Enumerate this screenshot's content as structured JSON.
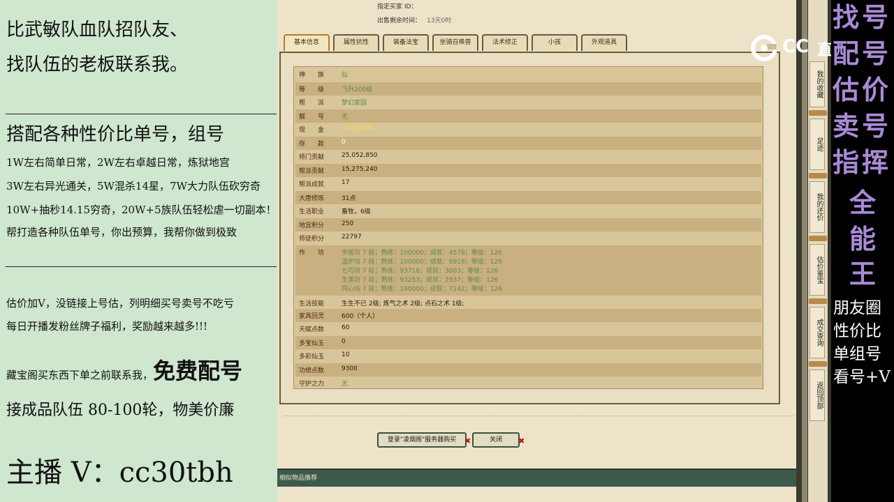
{
  "promo": {
    "l1": "比武敏队血队招队友、",
    "l2": "找队伍的老板联系我。",
    "l3": "搭配各种性价比单号，组号",
    "l4": "1W左右简单日常，2W左右卓越日常，炼狱地宫",
    "l5": "3W左右异光通关，5W混杀14星，7W大力队伍砍穷奇",
    "l6": "10W+抽秒14.15穷奇，20W+5族队伍轻松虐一切副本！",
    "l7": "帮打造各种队伍单号，你出预算，我帮你做到极致",
    "l8": "估价加V，没链接上号估，列明细买号卖号不吃亏",
    "l9": "每日开播发粉丝牌子福利，奖励越来越多!!!",
    "l10a": "藏宝阁买东西下单之前联系我，",
    "l10b": "免费配号",
    "l11": "接成品队伍 80-100轮，物美价廉",
    "l12": "主播 V：cc30tbh"
  },
  "header": {
    "buyer_label": "指定买家 ID：",
    "time_label": "出售剩余时间：",
    "time_value": "13天0时"
  },
  "tabs": [
    "基本信息",
    "属性抗性",
    "装备法宝",
    "坐骑召唤兽",
    "法术修正",
    "小孩",
    "外观道具"
  ],
  "info": {
    "r1": {
      "k": "神　　族",
      "v": "仙"
    },
    "r2": {
      "k": "等　　级",
      "v": "飞升200级"
    },
    "r3": {
      "k": "帮　　派",
      "v": "梦幻家园"
    },
    "r4": {
      "k": "靓　　号",
      "v": "无"
    },
    "r5": {
      "k": "现　　金",
      "v": "7,070,000"
    },
    "r6": {
      "k": "存　　款",
      "v": "0"
    },
    "r7": {
      "k": "师门贡献",
      "v": "25,052,850"
    },
    "r8": {
      "k": "帮派贡献",
      "v": "15,275,240"
    },
    "r9": {
      "k": "帮派成就",
      "v": "17"
    },
    "r10": {
      "k": "大唐修炼",
      "v": "31点"
    },
    "r11": {
      "k": "生活职业",
      "v": "畜牧，6级"
    },
    "r12": {
      "k": "地宫积分",
      "v": "250"
    },
    "r13": {
      "k": "师徒积分",
      "v": "22797"
    },
    "r14": {
      "k": "作　　坊"
    },
    "workshops": [
      "步摇坊 7 段；熟练：100000；成就：4578；等级：126",
      "温炉坊 7 段；熟练：100000；成就：6918；等级：126",
      "七巧坊 7 段；熟练：93716；成就：3003；等级：126",
      "生莲坊 7 段；熟练：93253；成就：2937；等级：126",
      "同心坊 7 段；熟练：100000；成就：7142；等级：126"
    ],
    "r15": {
      "k": "生活技能",
      "v": "生生不已 2级; 炼气之术 2级; 点石之术 1级;"
    },
    "r16": {
      "k": "家具回灵",
      "v": "600（个人）"
    },
    "r17": {
      "k": "天赋点数",
      "v": "60"
    },
    "r18": {
      "k": "多宝仙玉",
      "v": "0"
    },
    "r19": {
      "k": "多彩仙玉",
      "v": "10"
    },
    "r20": {
      "k": "功绩点数",
      "v": "9300"
    },
    "r21": {
      "k": "守护之力",
      "v": "无"
    }
  },
  "buttons": {
    "buy": "登录\"凌烟阁\"服务器购买",
    "close": "关闭"
  },
  "bottom_bar": "相似物品推荐",
  "right_menu": [
    "我的收藏",
    "足迹",
    "我的还价",
    "估价鉴宝",
    "成交查询",
    "返回顶部"
  ],
  "logo": {
    "a": "CC",
    "b": "直播"
  },
  "side_big": [
    [
      "找",
      "号"
    ],
    [
      "配",
      "号"
    ],
    [
      "估",
      "价"
    ],
    [
      "卖",
      "号"
    ],
    [
      "指",
      "挥"
    ],
    [
      "全"
    ],
    [
      "能"
    ],
    [
      "王"
    ]
  ],
  "side_small": [
    "朋友圈",
    "性价比",
    "单组号",
    "看号+V"
  ]
}
